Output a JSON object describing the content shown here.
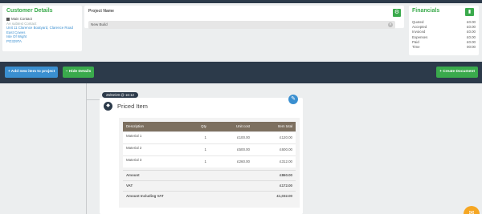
{
  "customer": {
    "title": "Customer Details",
    "main_contact": "Main Contact",
    "email": "AA subtext Contact",
    "address": [
      "Unit 11 Clarence Boatyard, Clarence Road",
      "East Cowes",
      "Isle Of Wight",
      "PO329TA"
    ]
  },
  "project": {
    "label": "Project Name",
    "value": "New Build"
  },
  "financials": {
    "title": "Financials",
    "rows": [
      {
        "label": "Quoted",
        "value": "£0.00"
      },
      {
        "label": "Accepted",
        "value": "£0.00"
      },
      {
        "label": "Invoiced",
        "value": "£0.00"
      },
      {
        "label": "Expenses",
        "value": "£0.00"
      },
      {
        "label": "Paid",
        "value": "£0.00"
      },
      {
        "label": "Time",
        "value": "00:00"
      }
    ]
  },
  "actions": {
    "add_item": "Add new item to project",
    "hide_details": "Hide Details",
    "create_document": "Create Document"
  },
  "item": {
    "date": "26/02/20 @ 16:12",
    "title": "Priced Item",
    "headers": {
      "description": "Description",
      "qty": "Qty",
      "unit_cost": "Unit cost",
      "total": "Item total"
    },
    "rows": [
      {
        "description": "Material 1",
        "qty": "1",
        "unit_cost": "£100.00",
        "total": "£120.00"
      },
      {
        "description": "Material 2",
        "qty": "1",
        "unit_cost": "£500.00",
        "total": "£600.00"
      },
      {
        "description": "Material 3",
        "qty": "1",
        "unit_cost": "£260.00",
        "total": "£312.00"
      }
    ],
    "summary": [
      {
        "label": "Amount",
        "value": "£860.00"
      },
      {
        "label": "VAT",
        "value": "£172.00"
      },
      {
        "label": "Amount Including VAT",
        "value": "£1,032.00"
      }
    ]
  },
  "icons": {
    "customer_main": "person-icon",
    "project_action": "settings-icon",
    "financials_action": "chart-icon",
    "item_type": "tag-icon",
    "edit": "pencil-icon",
    "chat": "chat-icon"
  },
  "colors": {
    "accent_green": "#3aaa4c",
    "accent_blue": "#3a8fd0",
    "navy": "#2c3a4a",
    "table_header": "#7d7060",
    "chat": "#f5a623"
  }
}
